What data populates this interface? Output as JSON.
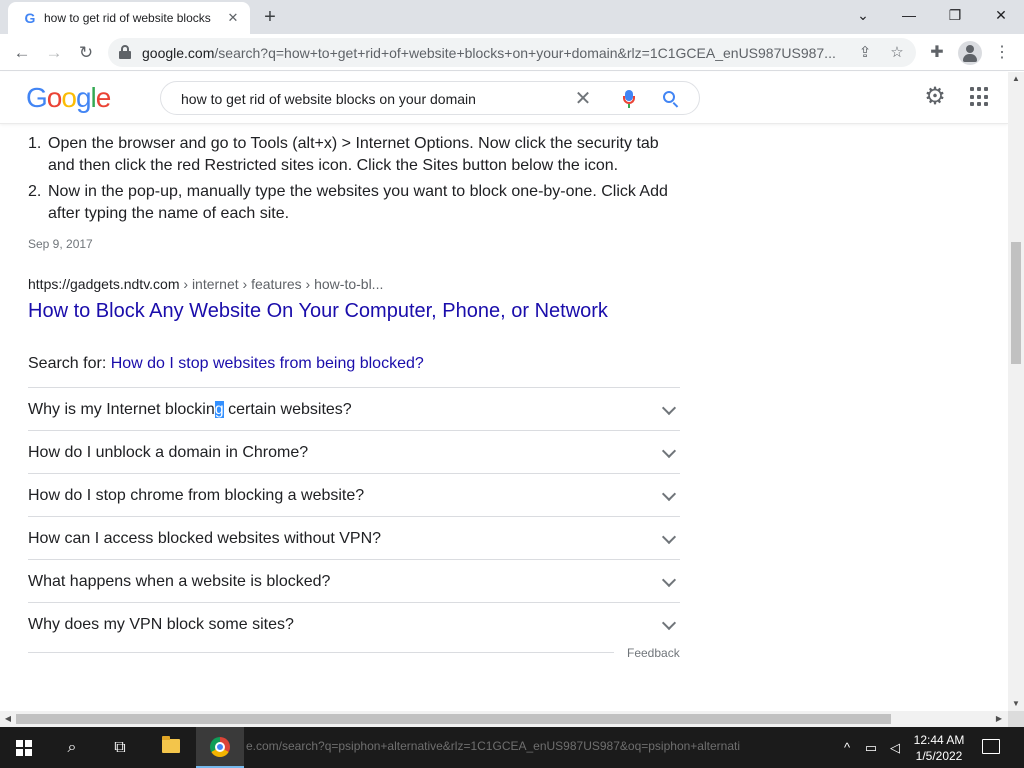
{
  "browser": {
    "tab_title": "how to get rid of website blocks",
    "tab_favicon": "G",
    "tab_close": "✕",
    "new_tab": "+",
    "url_host": "google.com",
    "url_rest": "/search?q=how+to+get+rid+of+website+blocks+on+your+domain&rlz=1C1GCEA_enUS987US987...",
    "window_controls": {
      "tabsearch": "⌄",
      "minimize": "—",
      "restore": "❐",
      "close": "✕"
    }
  },
  "google": {
    "logo": [
      "G",
      "o",
      "o",
      "g",
      "l",
      "e"
    ],
    "logo_colors": [
      "#4285f4",
      "#ea4335",
      "#fbbc05",
      "#4285f4",
      "#34a853",
      "#ea4335"
    ],
    "query": "how to get rid of website blocks on your domain"
  },
  "result": {
    "steps": [
      {
        "num": "1.",
        "text": "Open the browser and go to Tools (alt+x) > Internet Options. Now click the security tab and then click the red Restricted sites icon. Click the Sites button below the icon."
      },
      {
        "num": "2.",
        "text": "Now in the pop-up, manually type the websites you want to block one-by-one. Click Add after typing the name of each site."
      }
    ],
    "date": "Sep 9, 2017",
    "cite_host": "https://gadgets.ndtv.com",
    "cite_path": " › internet › features › how-to-bl...",
    "title": "How to Block Any Website On Your Computer, Phone, or Network",
    "search_for_label": "Search for: ",
    "search_for_link": "How do I stop websites from being blocked?"
  },
  "paa": {
    "first_pre": "Why is my Internet blockin",
    "first_sel": "g",
    "first_post": " certain websites?",
    "questions": [
      "How do I unblock a domain in Chrome?",
      "How do I stop chrome from blocking a website?",
      "How can I access blocked websites without VPN?",
      "What happens when a website is blocked?",
      "Why does my VPN block some sites?"
    ],
    "feedback": "Feedback"
  },
  "taskbar": {
    "ghost_url": "e.com/search?q=psiphon+alternative&rlz=1C1GCEA_enUS987US987&oq=psiphon+alternati",
    "time": "12:44 AM",
    "date": "1/5/2022"
  },
  "colors": {
    "link": "#1a0dab",
    "selection": "#3390ff",
    "taskbar": "#1b1b1b"
  }
}
